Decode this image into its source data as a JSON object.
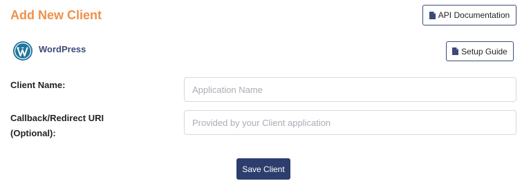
{
  "header": {
    "title": "Add New Client",
    "api_doc_label": "API Documentation",
    "api_doc_icon": "file-icon"
  },
  "platform": {
    "name": "WordPress",
    "logo_icon": "wordpress-logo-icon",
    "setup_guide_label": "Setup Guide"
  },
  "form": {
    "client_name_label": "Client Name:",
    "client_name_placeholder": "Application Name",
    "client_name_value": "",
    "callback_label_line1": "Callback/Redirect URI",
    "callback_label_line2": "(Optional):",
    "callback_placeholder": "Provided by your Client application",
    "callback_value": "",
    "save_label": "Save Client"
  },
  "colors": {
    "title_accent": "#f0904a",
    "brand_navy": "#2d3e6d",
    "wordpress_blue": "#21759b"
  }
}
